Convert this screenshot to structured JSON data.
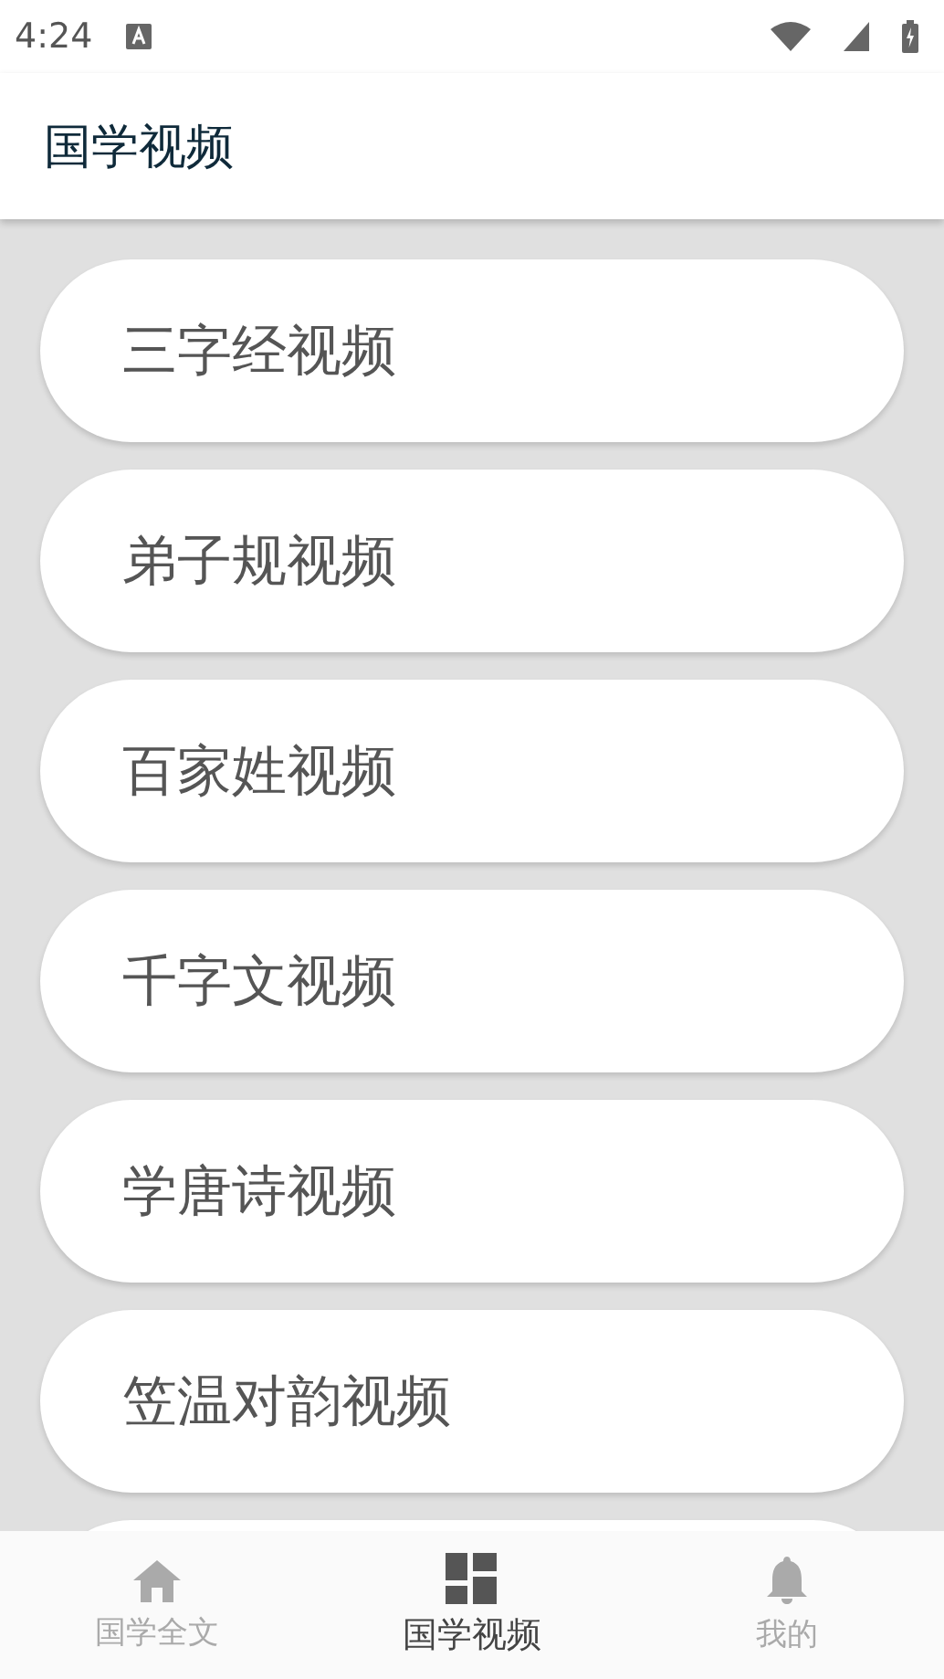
{
  "status_bar": {
    "time": "4:24"
  },
  "app_bar": {
    "title": "国学视频"
  },
  "items": [
    {
      "label": "三字经视频"
    },
    {
      "label": "弟子规视频"
    },
    {
      "label": "百家姓视频"
    },
    {
      "label": "千字文视频"
    },
    {
      "label": "学唐诗视频"
    },
    {
      "label": "笠温对韵视频"
    }
  ],
  "bottom_nav": [
    {
      "kind": "home",
      "label": "国学全文",
      "selected": false
    },
    {
      "kind": "grid",
      "label": "国学视频",
      "selected": true
    },
    {
      "kind": "bell",
      "label": "我的",
      "selected": false
    }
  ]
}
